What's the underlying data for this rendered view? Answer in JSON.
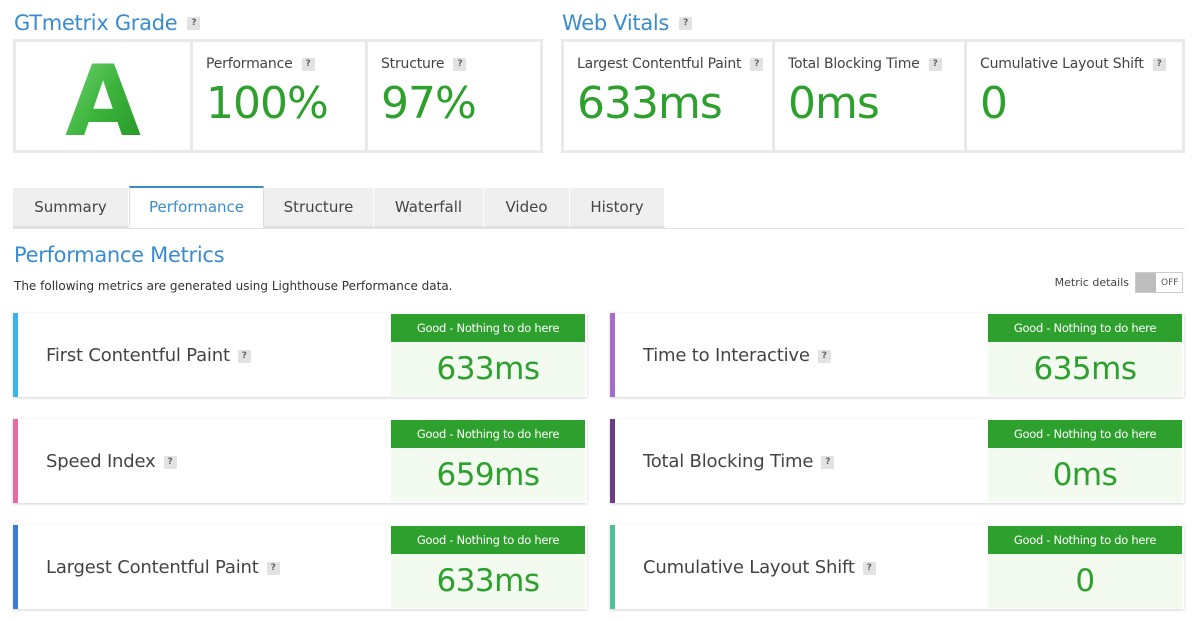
{
  "grade": {
    "title": "GTmetrix Grade",
    "letter": "A",
    "performance_label": "Performance",
    "performance_value": "100%",
    "structure_label": "Structure",
    "structure_value": "97%"
  },
  "vitals": {
    "title": "Web Vitals",
    "items": [
      {
        "label": "Largest Contentful Paint",
        "value": "633ms"
      },
      {
        "label": "Total Blocking Time",
        "value": "0ms"
      },
      {
        "label": "Cumulative Layout Shift",
        "value": "0"
      }
    ]
  },
  "tabs": [
    "Summary",
    "Performance",
    "Structure",
    "Waterfall",
    "Video",
    "History"
  ],
  "active_tab": "Performance",
  "perf": {
    "title": "Performance Metrics",
    "description": "The following metrics are generated using Lighthouse Performance data.",
    "metric_details_label": "Metric details",
    "toggle_state": "OFF"
  },
  "help_glyph": "?",
  "metrics": [
    {
      "name": "First Contentful Paint",
      "status": "Good - Nothing to do here",
      "value": "633ms",
      "color": "#3db3e8"
    },
    {
      "name": "Time to Interactive",
      "status": "Good - Nothing to do here",
      "value": "635ms",
      "color": "#a56dc9"
    },
    {
      "name": "Speed Index",
      "status": "Good - Nothing to do here",
      "value": "659ms",
      "color": "#e86aa4"
    },
    {
      "name": "Total Blocking Time",
      "status": "Good - Nothing to do here",
      "value": "0ms",
      "color": "#6b3e83"
    },
    {
      "name": "Largest Contentful Paint",
      "status": "Good - Nothing to do here",
      "value": "633ms",
      "color": "#3b7ad8"
    },
    {
      "name": "Cumulative Layout Shift",
      "status": "Good - Nothing to do here",
      "value": "0",
      "color": "#4fbf9a"
    }
  ],
  "colors": {
    "accent": "#3a8ccf",
    "good": "#2ea02e",
    "good_bg": "#f3fbf1"
  }
}
